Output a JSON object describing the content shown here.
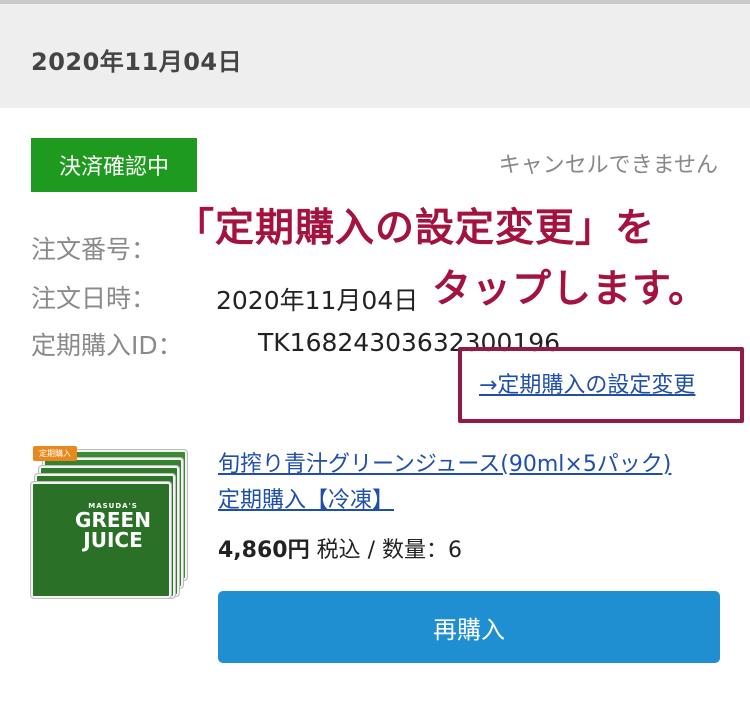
{
  "order": {
    "date": "2020年11月04日",
    "status_badge": "決済確認中",
    "cancel_note": "キャンセルできません",
    "order_number_label": "注文番号：",
    "order_datetime_label": "注文日時：",
    "order_datetime_value": "2020年11月04日",
    "subscription_id_label": "定期購入ID：",
    "subscription_id_value": "TK16824303632300196",
    "settings_link": "→定期購入の設定変更"
  },
  "annotation": {
    "line1": "「定期購入の設定変更」を",
    "line2": "タップします。"
  },
  "product": {
    "image_tag": "定期購入",
    "image_brand_small": "MASUDA'S",
    "image_brand_line1": "GREEN",
    "image_brand_line2": "JUICE",
    "title_line1": "旬搾り青汁グリーンジュース(90ml×5パック)",
    "title_line2": "定期購入【冷凍】",
    "price": "4,860円",
    "price_detail": " 税込 / 数量：6",
    "rebuy_button": "再購入"
  },
  "colors": {
    "status_green": "#1e9a1e",
    "link_blue": "#1f4fa8",
    "button_blue": "#1f8fd1",
    "annotation_red": "#a4123e"
  }
}
